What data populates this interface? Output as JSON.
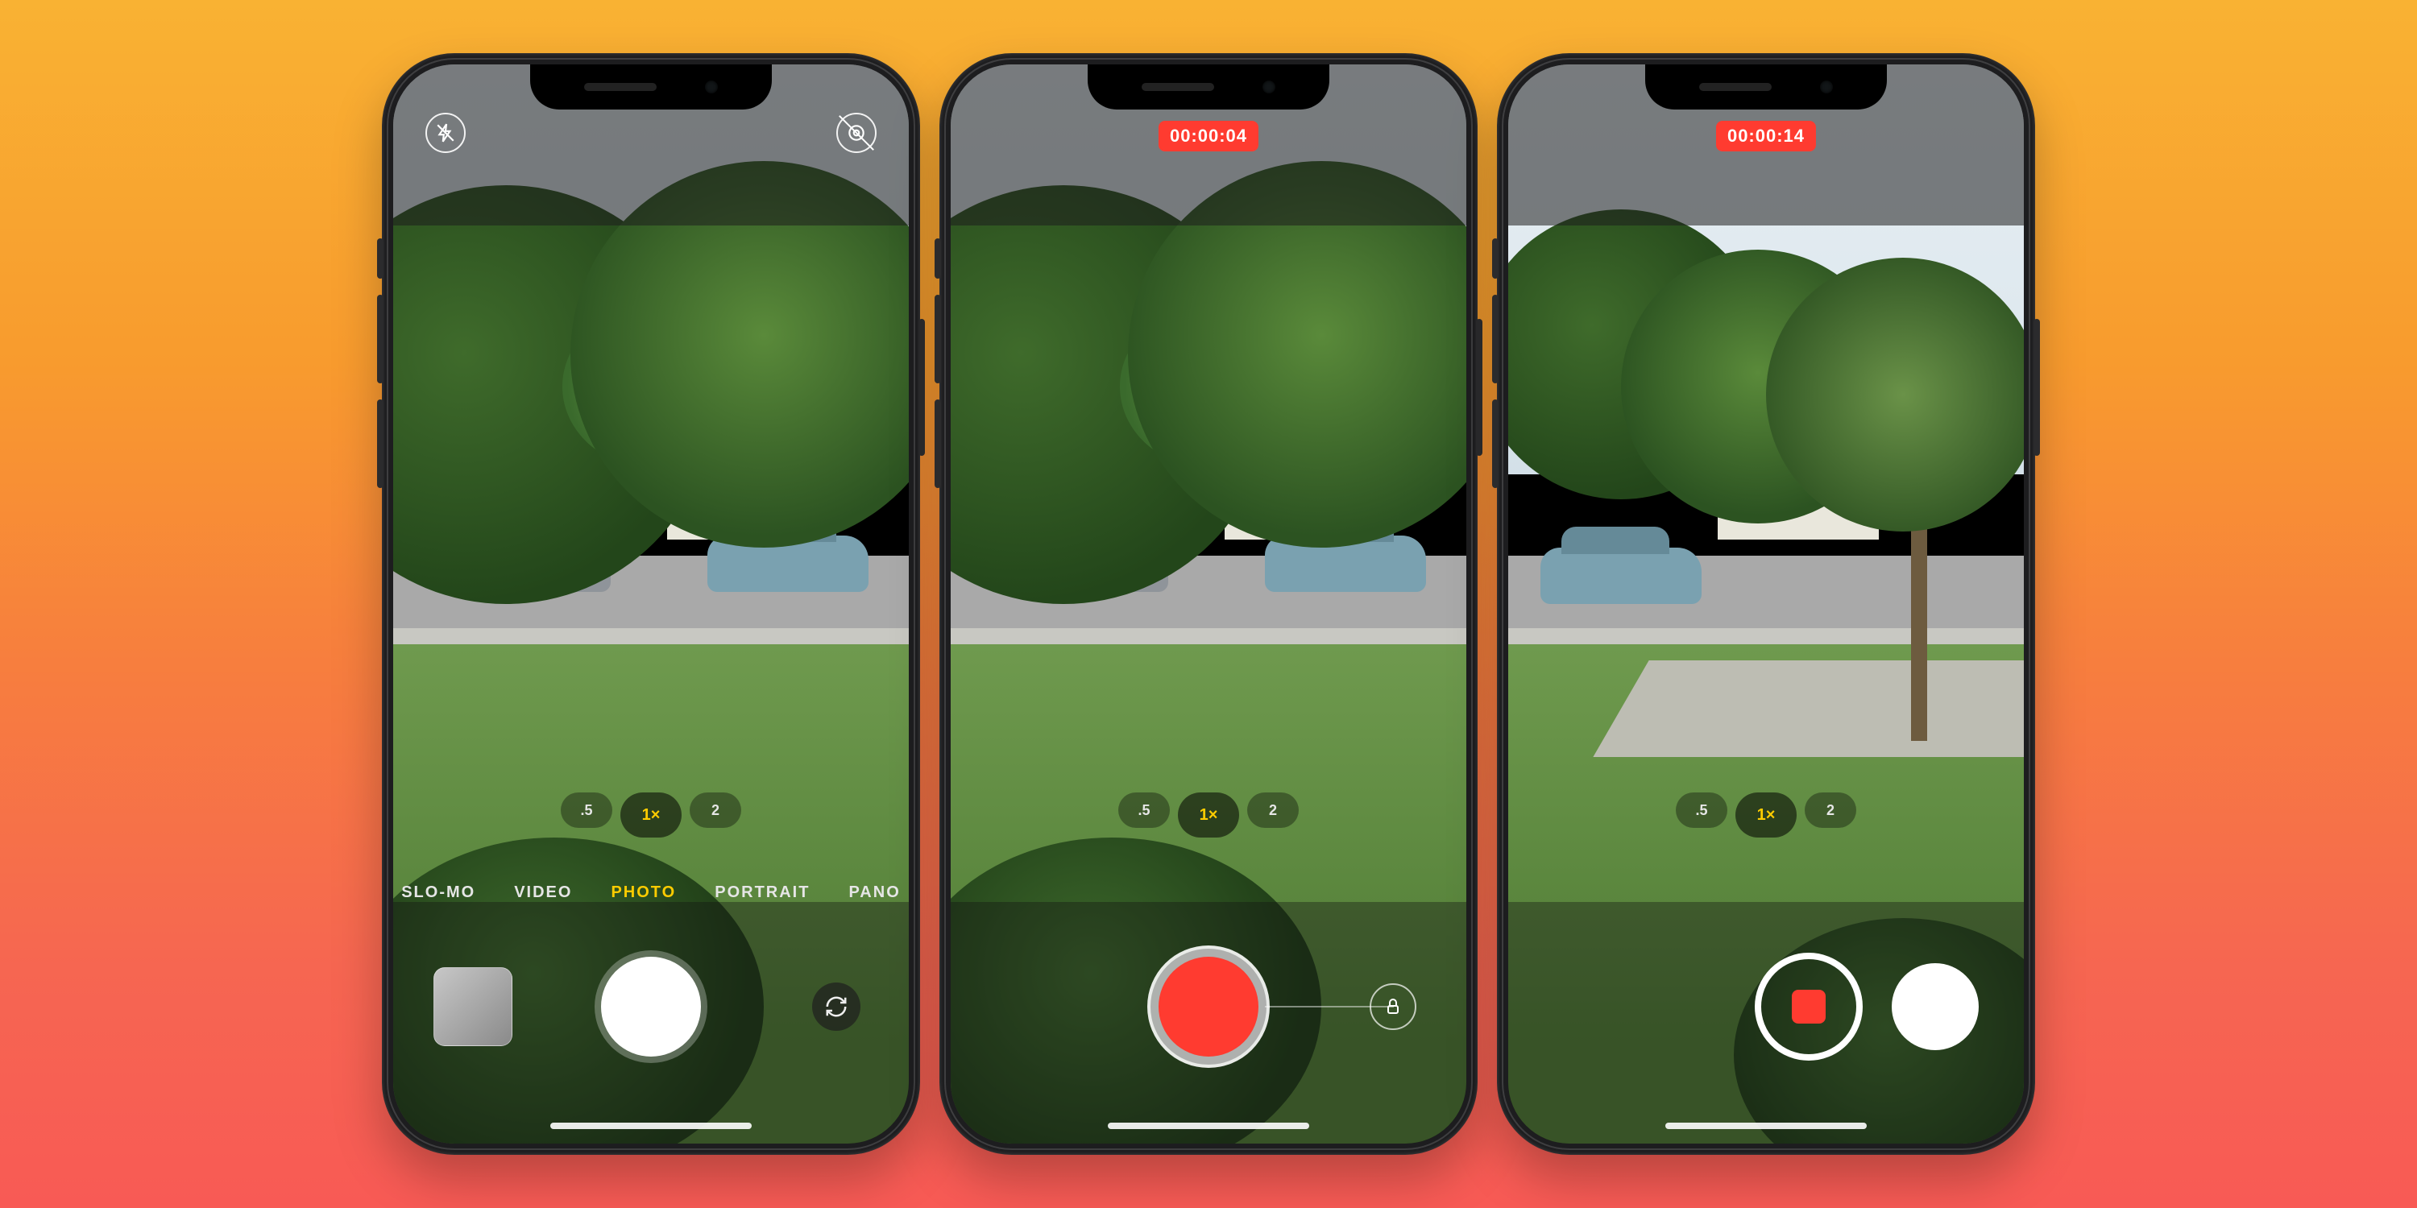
{
  "colors": {
    "accent": "#ffcc00",
    "record": "#ff3b30"
  },
  "icons": {
    "flash": "flash-off",
    "live": "live-photo-off",
    "flip": "camera-flip",
    "lock": "lock"
  },
  "zoom": {
    "options": [
      ".5",
      "1×",
      "2"
    ],
    "active": "1×"
  },
  "modes": {
    "items": [
      "SLO-MO",
      "VIDEO",
      "PHOTO",
      "PORTRAIT",
      "PANO"
    ],
    "active": "PHOTO"
  },
  "phones": [
    {
      "topIcons": true,
      "recording": null,
      "showModes": true,
      "shutter": "photo",
      "thumb": true,
      "flip": true,
      "lock": false,
      "photoBtn": false,
      "zoomVisible": true,
      "scene": "std"
    },
    {
      "topIcons": false,
      "recording": "00:00:04",
      "showModes": false,
      "shutter": "record",
      "thumb": false,
      "flip": false,
      "lock": true,
      "photoBtn": false,
      "zoomVisible": true,
      "scene": "std"
    },
    {
      "topIcons": false,
      "recording": "00:00:14",
      "showModes": false,
      "shutter": "stop",
      "thumb": false,
      "flip": false,
      "lock": false,
      "photoBtn": true,
      "zoomVisible": true,
      "scene": "wide"
    }
  ]
}
